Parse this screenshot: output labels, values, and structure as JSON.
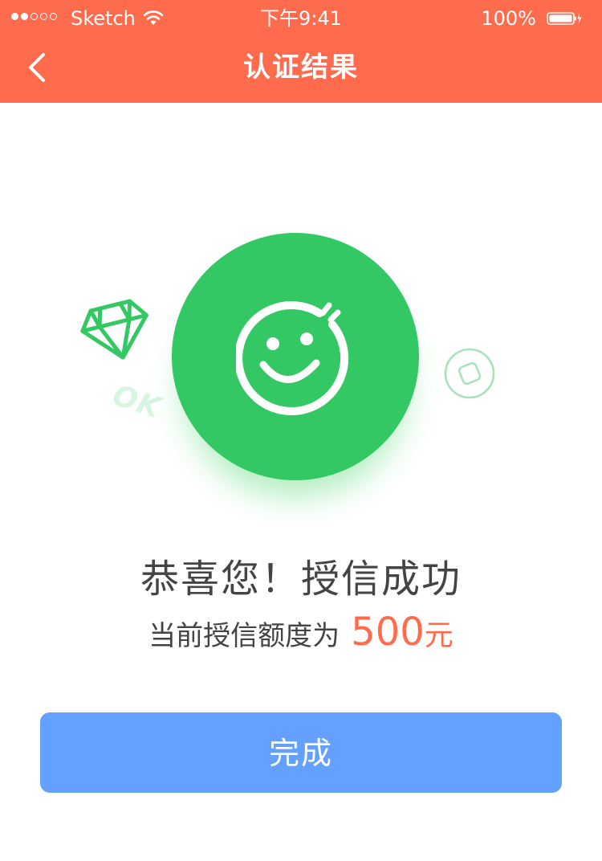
{
  "status_bar": {
    "carrier": "Sketch",
    "time": "下午9:41",
    "battery": "100%"
  },
  "nav": {
    "title": "认证结果",
    "back_icon": "chevron-left-icon"
  },
  "illustration": {
    "main_icon": "smiley-face-icon",
    "decor": [
      "diamond-icon",
      "ok-text",
      "coin-icon"
    ],
    "ok_text": "OK"
  },
  "result": {
    "title": "恭喜您！授信成功",
    "credit_label": "当前授信额度为",
    "credit_amount": "500",
    "credit_unit": "元"
  },
  "actions": {
    "done_label": "完成"
  },
  "colors": {
    "header": "#FF6B4D",
    "success_green": "#33C864",
    "amount": "#FF6B4D",
    "button": "#64A0FF",
    "text": "#444444"
  }
}
